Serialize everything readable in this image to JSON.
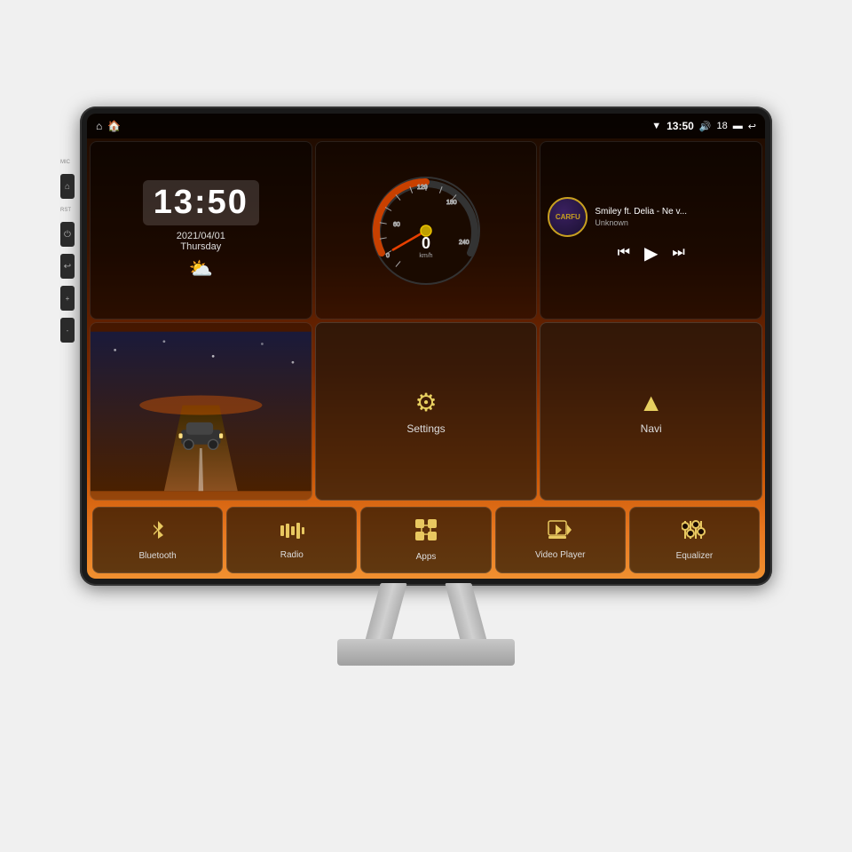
{
  "device": {
    "title": "Car Android Head Unit"
  },
  "statusBar": {
    "leftIcons": [
      "home",
      "house"
    ],
    "time": "13:50",
    "wifi": "▼",
    "volume": "🔊",
    "battery": "18",
    "screen": "▬",
    "back": "↩"
  },
  "clock": {
    "time": "13:50",
    "date": "2021/04/01",
    "day": "Thursday"
  },
  "music": {
    "title": "Smiley ft. Delia - Ne v...",
    "artist": "Unknown",
    "albumLabel": "CARFU"
  },
  "widgets": {
    "settings": "Settings",
    "navi": "Navi"
  },
  "apps": [
    {
      "id": "bluetooth",
      "label": "Bluetooth",
      "icon": "bluetooth"
    },
    {
      "id": "radio",
      "label": "Radio",
      "icon": "radio"
    },
    {
      "id": "apps",
      "label": "Apps",
      "icon": "apps"
    },
    {
      "id": "video",
      "label": "Video Player",
      "icon": "video"
    },
    {
      "id": "equalizer",
      "label": "Equalizer",
      "icon": "equalizer"
    }
  ],
  "sideButtons": [
    {
      "id": "mic",
      "label": "MIC"
    },
    {
      "id": "home",
      "label": "⌂"
    },
    {
      "id": "rst",
      "label": "RST"
    },
    {
      "id": "power",
      "label": "⏻"
    },
    {
      "id": "back",
      "label": "←"
    },
    {
      "id": "vol-up",
      "label": "◄+"
    },
    {
      "id": "vol-down",
      "label": "◄-"
    }
  ]
}
